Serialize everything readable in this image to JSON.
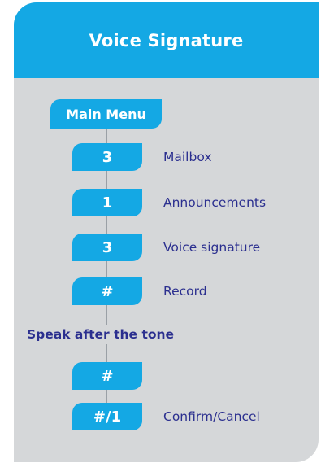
{
  "title": "Voice Signature",
  "main_menu": "Main Menu",
  "steps": [
    {
      "key": "3",
      "label": "Mailbox"
    },
    {
      "key": "1",
      "label": "Announcements"
    },
    {
      "key": "3",
      "label": "Voice signature"
    },
    {
      "key": "#",
      "label": "Record"
    }
  ],
  "instruction": "Speak after the tone",
  "final_steps": [
    {
      "key": "#",
      "label": ""
    },
    {
      "key": "#/1",
      "label": "Confirm/Cancel"
    }
  ],
  "colors": {
    "accent": "#14a8e4",
    "panel": "#d5d7d9",
    "text": "#2b2f8f",
    "connector": "#9aa0a6"
  }
}
